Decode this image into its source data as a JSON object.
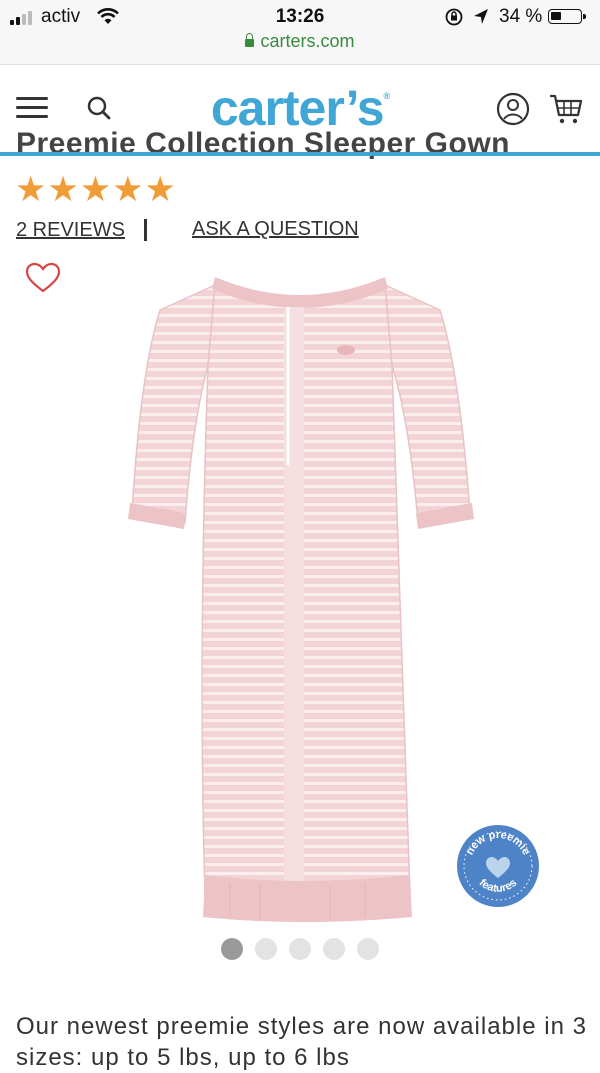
{
  "status_bar": {
    "carrier": "activ",
    "time": "13:26",
    "battery_percent": "34 %",
    "battery_level": 0.34,
    "url": "carters.com"
  },
  "header": {
    "logo": "carter's",
    "icons": [
      "menu-icon",
      "search-icon",
      "account-icon",
      "cart-icon"
    ],
    "accent_color": "#3fa6d6"
  },
  "product": {
    "title": "Preemie Collection Sleeper Gown",
    "rating_stars": 5,
    "stars_text": "★★★★★",
    "star_color": "#f29c38",
    "reviews_link": "2 REVIEWS",
    "separator": "|",
    "ask_link": "ASK A QUESTION",
    "badge_line1": "new preemie",
    "badge_line2": "features",
    "carousel_total": 5,
    "carousel_active": 1,
    "description": "Our newest preemie styles are now available in 3 sizes: up to 5 lbs, up to 6 lbs"
  }
}
